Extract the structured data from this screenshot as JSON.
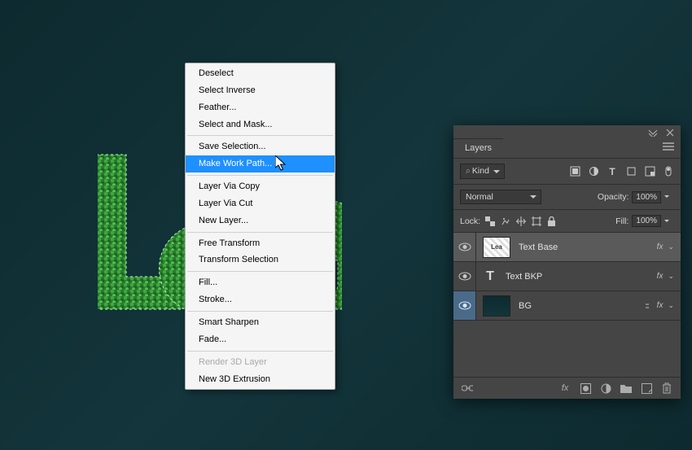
{
  "context_menu": {
    "items": [
      {
        "label": "Deselect"
      },
      {
        "label": "Select Inverse"
      },
      {
        "label": "Feather..."
      },
      {
        "label": "Select and Mask..."
      },
      {
        "sep": true
      },
      {
        "label": "Save Selection..."
      },
      {
        "label": "Make Work Path...",
        "hover": true
      },
      {
        "sep": true
      },
      {
        "label": "Layer Via Copy"
      },
      {
        "label": "Layer Via Cut"
      },
      {
        "label": "New Layer..."
      },
      {
        "sep": true
      },
      {
        "label": "Free Transform"
      },
      {
        "label": "Transform Selection"
      },
      {
        "sep": true
      },
      {
        "label": "Fill..."
      },
      {
        "label": "Stroke..."
      },
      {
        "sep": true
      },
      {
        "label": "Smart Sharpen"
      },
      {
        "label": "Fade..."
      },
      {
        "sep": true
      },
      {
        "label": "Render 3D Layer",
        "disabled": true
      },
      {
        "label": "New 3D Extrusion"
      }
    ]
  },
  "layers_panel": {
    "tab": "Layers",
    "kind_label": "Kind",
    "blend_mode": "Normal",
    "opacity_label": "Opacity:",
    "opacity_value": "100%",
    "lock_label": "Lock:",
    "fill_label": "Fill:",
    "fill_value": "100%",
    "layers": [
      {
        "name": "Text Base",
        "fx": true,
        "selected": true
      },
      {
        "name": "Text BKP",
        "fx": true,
        "type": "T"
      },
      {
        "name": "BG",
        "fx": true,
        "bg": true,
        "link": true,
        "active_vis": true
      }
    ]
  }
}
